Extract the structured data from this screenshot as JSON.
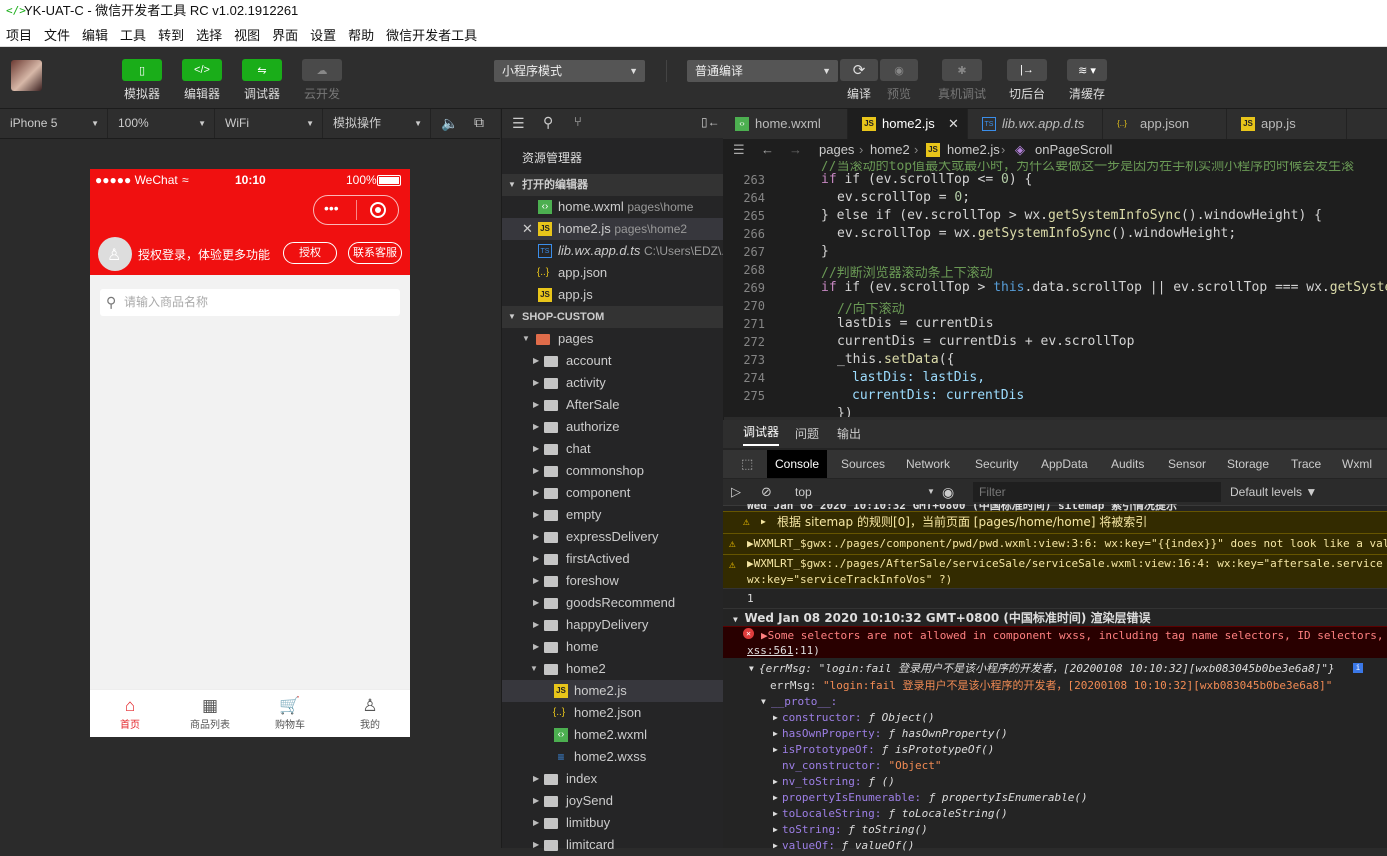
{
  "window": {
    "title": "YK-UAT-C - 微信开发者工具 RC v1.02.1912261",
    "logo_text": "</>"
  },
  "menu": [
    "项目",
    "文件",
    "编辑",
    "工具",
    "转到",
    "选择",
    "视图",
    "界面",
    "设置",
    "帮助",
    "微信开发者工具"
  ],
  "toolbar": {
    "simulator": "模拟器",
    "editor": "编辑器",
    "debugger": "调试器",
    "cloud": "云开发",
    "mode": "小程序模式",
    "compile": "普通编译",
    "build": "编译",
    "preview": "预览",
    "remote_debug": "真机调试",
    "background": "切后台",
    "clear_cache": "清缓存"
  },
  "simbar": {
    "device": "iPhone 5",
    "zoom": "100%",
    "network": "WiFi",
    "ops": "模拟操作"
  },
  "phone": {
    "carrier": "●●●●● WeChat",
    "time": "10:10",
    "battery": "100%",
    "login_text": "授权登录，体验更多功能",
    "auth_btn": "授权",
    "service_btn": "联系客服",
    "search_placeholder": "请输入商品名称",
    "tabs": [
      {
        "label": "首页",
        "icon": "⌂"
      },
      {
        "label": "商品列表",
        "icon": "▦"
      },
      {
        "label": "购物车",
        "icon": "🛒"
      },
      {
        "label": "我的",
        "icon": "♙"
      }
    ]
  },
  "explorer": {
    "title": "资源管理器",
    "open_section": "打开的编辑器",
    "project_section": "SHOP-CUSTOM",
    "open_files": [
      {
        "name": "home.wxml",
        "path": "pages\\home"
      },
      {
        "name": "home2.js",
        "path": "pages\\home2"
      },
      {
        "name": "lib.wx.app.d.ts",
        "path": "C:\\Users\\EDZ\\..."
      },
      {
        "name": "app.json",
        "path": ""
      },
      {
        "name": "app.js",
        "path": ""
      }
    ],
    "pages_folder": "pages",
    "folders_a": [
      "account",
      "activity",
      "AfterSale",
      "authorize",
      "chat",
      "commonshop",
      "component",
      "empty",
      "expressDelivery",
      "firstActived",
      "foreshow",
      "goodsRecommend",
      "happyDelivery",
      "home"
    ],
    "home2_folder": "home2",
    "home2_files": [
      "home2.js",
      "home2.json",
      "home2.wxml",
      "home2.wxss"
    ],
    "folders_b": [
      "index",
      "joySend",
      "limitbuy",
      "limitcard"
    ]
  },
  "tabs": [
    "home.wxml",
    "home2.js",
    "lib.wx.app.d.ts",
    "app.json",
    "app.js"
  ],
  "breadcrumb": [
    "pages",
    "home2",
    "home2.js",
    "onPageScroll"
  ],
  "code": {
    "line_numbers": [
      "263",
      "264",
      "265",
      "266",
      "267",
      "268",
      "269",
      "270",
      "271",
      "272",
      "273",
      "274",
      "275"
    ],
    "top_comment": "//当滚动的top值最大或最小时，为什么要做这一步是因为在手机实测小程序的时候会发生滚",
    "l263": [
      "if (ev.scrollTop <= ",
      "0",
      ") {"
    ],
    "l264": [
      "ev.scrollTop = ",
      "0",
      ";"
    ],
    "l265": [
      "} else if (ev.scrollTop > wx.",
      "getSystemInfoSync",
      "().windowHeight) {"
    ],
    "l266": [
      "ev.scrollTop = wx.",
      "getSystemInfoSync",
      "().windowHeight;"
    ],
    "l267": "}",
    "l268": "//判断浏览器滚动条上下滚动",
    "l269": [
      "if (ev.scrollTop > ",
      "this",
      ".data.scrollTop || ev.scrollTop === wx.",
      "getSystemInf"
    ],
    "l270": "//向下滚动",
    "l271": "lastDis = currentDis",
    "l272": "currentDis = currentDis + ev.scrollTop",
    "l273": [
      "_this.",
      "setData",
      "({"
    ],
    "l274": "lastDis: lastDis,",
    "l275": "currentDis: currentDis",
    "l276": "})"
  },
  "debugger": {
    "top_tabs": [
      "调试器",
      "问题",
      "输出"
    ],
    "console_tabs": [
      "Console",
      "Sources",
      "Network",
      "Security",
      "AppData",
      "Audits",
      "Sensor",
      "Storage",
      "Trace",
      "Wxml"
    ],
    "context": "top",
    "filter_placeholder": "Filter",
    "levels": "Default levels ▼",
    "cut_line": "Wed Jan 08 2020 10:10:32 GMT+0800 (中国标准时间) sitemap 索引情况提示",
    "warn1": "根据 sitemap 的规则[0]，当前页面 [pages/home/home] 将被索引",
    "warn2": "WXMLRT_$gwx:./pages/component/pwd/pwd.wxml:view:3:6: wx:key=\"{{index}}\" does not look like a val",
    "warn3a": "WXMLRT_$gwx:./pages/AfterSale/serviceSale/serviceSale.wxml:view:16:4: wx:key=\"aftersale.service",
    "warn3b": "wx:key=\"serviceTrackInfoVos\" ?)",
    "num": "1",
    "group": "Wed Jan 08 2020 10:10:32 GMT+0800 (中国标准时间) 渲染层错误",
    "err1": "Some selectors are not allowed in component wxss, including tag name selectors, ID selectors,",
    "err1_src": "xss:561",
    "err1_src_tail": ":11)",
    "obj_head": "{errMsg: \"login:fail 登录用户不是该小程序的开发者，[20200108 10:10:32][wxb083045b0be3e6a8]\"}",
    "errmsg_key": "errMsg:",
    "errmsg_val": "\"login:fail 登录用户不是该小程序的开发者，[20200108 10:10:32][wxb083045b0be3e6a8]\"",
    "proto": "__proto__:",
    "proto_items": [
      {
        "k": "constructor:",
        "v": "ƒ Object()"
      },
      {
        "k": "hasOwnProperty:",
        "v": "ƒ hasOwnProperty()"
      },
      {
        "k": "isPrototypeOf:",
        "v": "ƒ isPrototypeOf()"
      },
      {
        "k": "nv_constructor:",
        "v": "\"Object\""
      },
      {
        "k": "nv_toString:",
        "v": "ƒ ()"
      },
      {
        "k": "propertyIsEnumerable:",
        "v": "ƒ propertyIsEnumerable()"
      },
      {
        "k": "toLocaleString:",
        "v": "ƒ toLocaleString()"
      },
      {
        "k": "toString:",
        "v": "ƒ toString()"
      },
      {
        "k": "valueOf:",
        "v": "ƒ valueOf()"
      }
    ]
  }
}
